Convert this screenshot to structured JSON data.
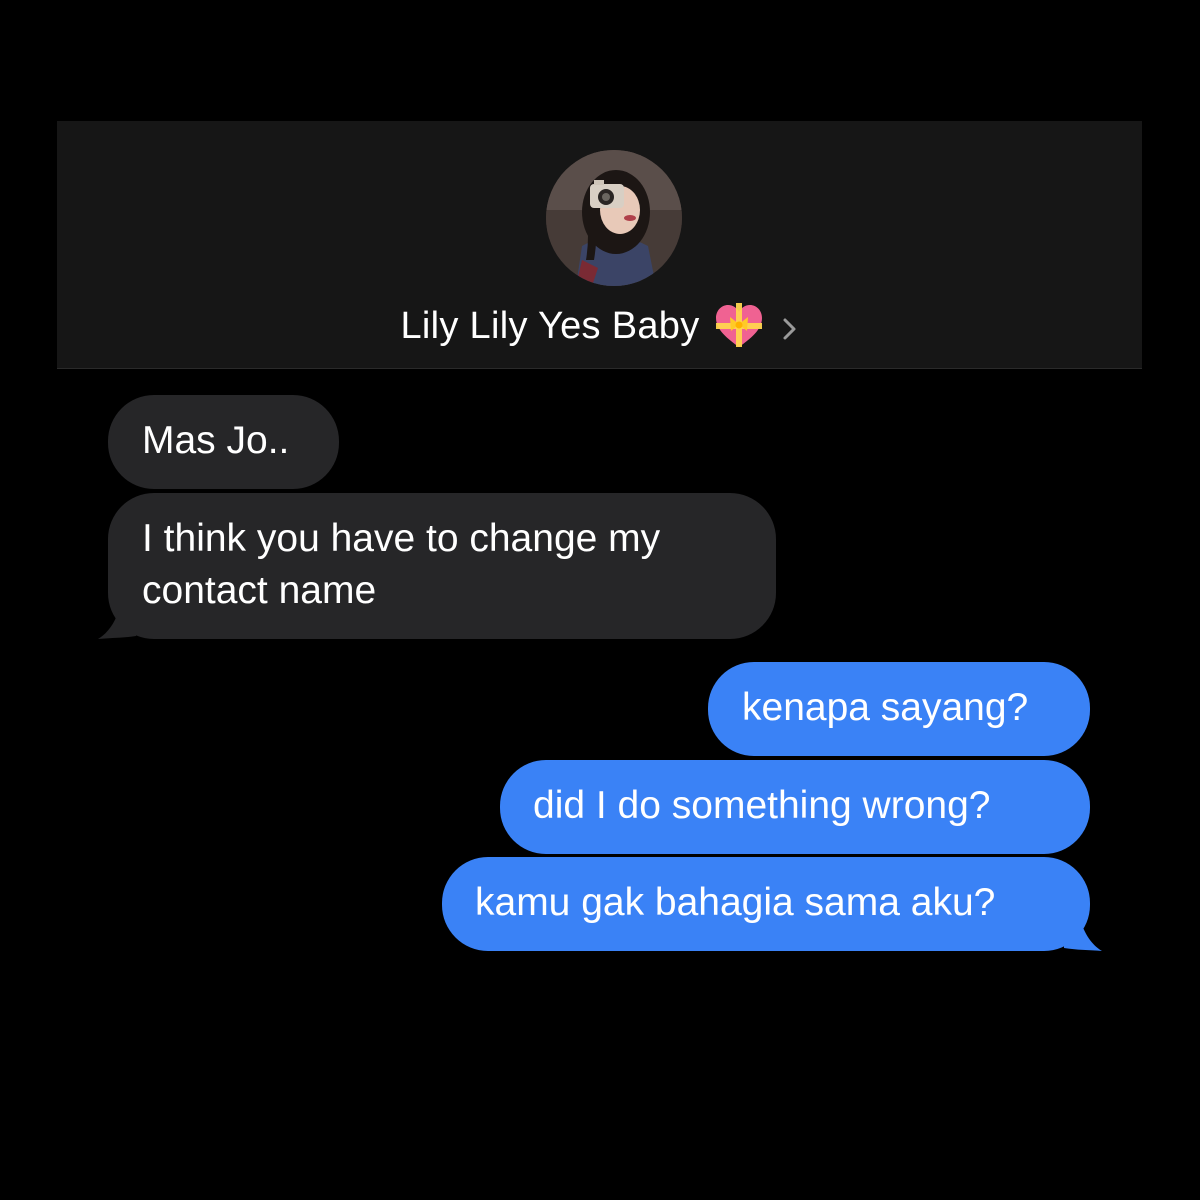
{
  "header": {
    "contact_name": "Lily Lily Yes Baby",
    "avatar_icon": "profile-photo-avatar",
    "emoji_icon": "heart-with-ribbon-icon",
    "chevron_icon": "chevron-right-icon"
  },
  "messages": [
    {
      "direction": "incoming",
      "text": "Mas Jo.."
    },
    {
      "direction": "incoming",
      "text": "I think you have to change my contact name"
    },
    {
      "direction": "outgoing",
      "text": "kenapa sayang?"
    },
    {
      "direction": "outgoing",
      "text": "did I do something wrong?"
    },
    {
      "direction": "outgoing",
      "text": "kamu gak bahagia sama aku?"
    }
  ],
  "colors": {
    "background": "#000000",
    "header_background": "#161616",
    "incoming_bubble": "#262628",
    "outgoing_bubble": "#3a82f6",
    "text": "#ffffff"
  }
}
